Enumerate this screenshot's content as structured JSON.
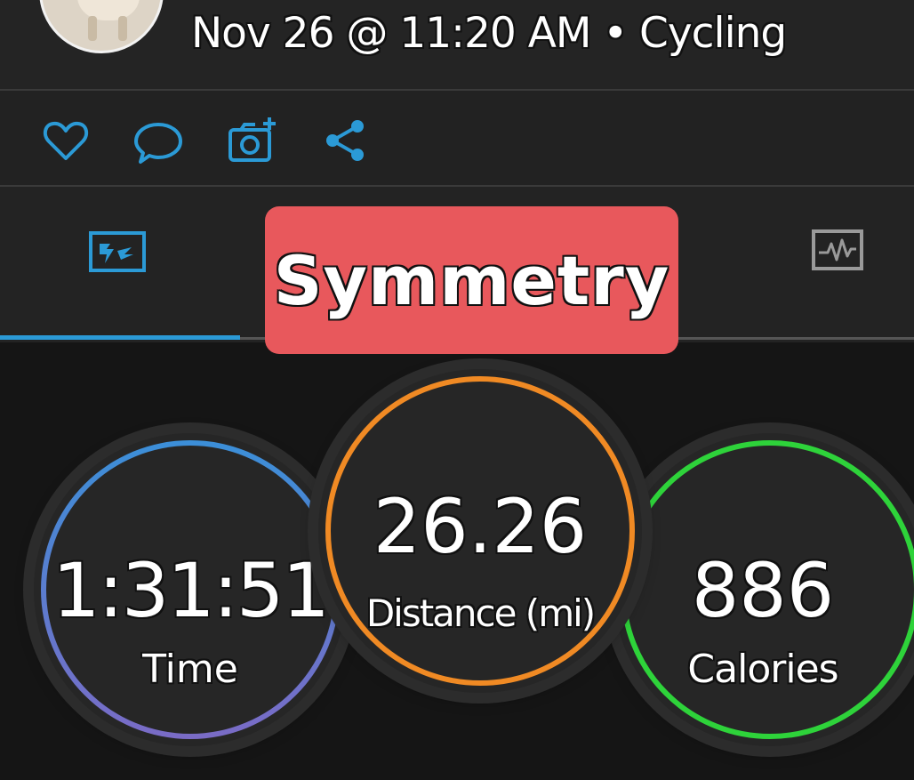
{
  "header": {
    "title": "Nov 26 @ 11:20 AM • Cycling"
  },
  "actions": [
    {
      "icon": "heart-icon"
    },
    {
      "icon": "comment-icon"
    },
    {
      "icon": "add-photo-icon"
    },
    {
      "icon": "share-icon"
    }
  ],
  "tabs": {
    "active_icon": "stats-flag-icon",
    "other_icon": "activity-chart-icon"
  },
  "tooltip": {
    "text": "Symmetry"
  },
  "stats": {
    "time": {
      "value": "1:31:51",
      "label": "Time"
    },
    "distance": {
      "value": "26.26",
      "label": "Distance (mi)"
    },
    "calories": {
      "value": "886",
      "label": "Calories"
    }
  },
  "colors": {
    "accent": "#2b9ad6",
    "tooltip": "#e8585c",
    "distance_ring": "#f08a24",
    "calories_ring": "#2ed33a",
    "time_ring_top": "#3b8fd8",
    "time_ring_bottom": "#7a6bc6"
  }
}
